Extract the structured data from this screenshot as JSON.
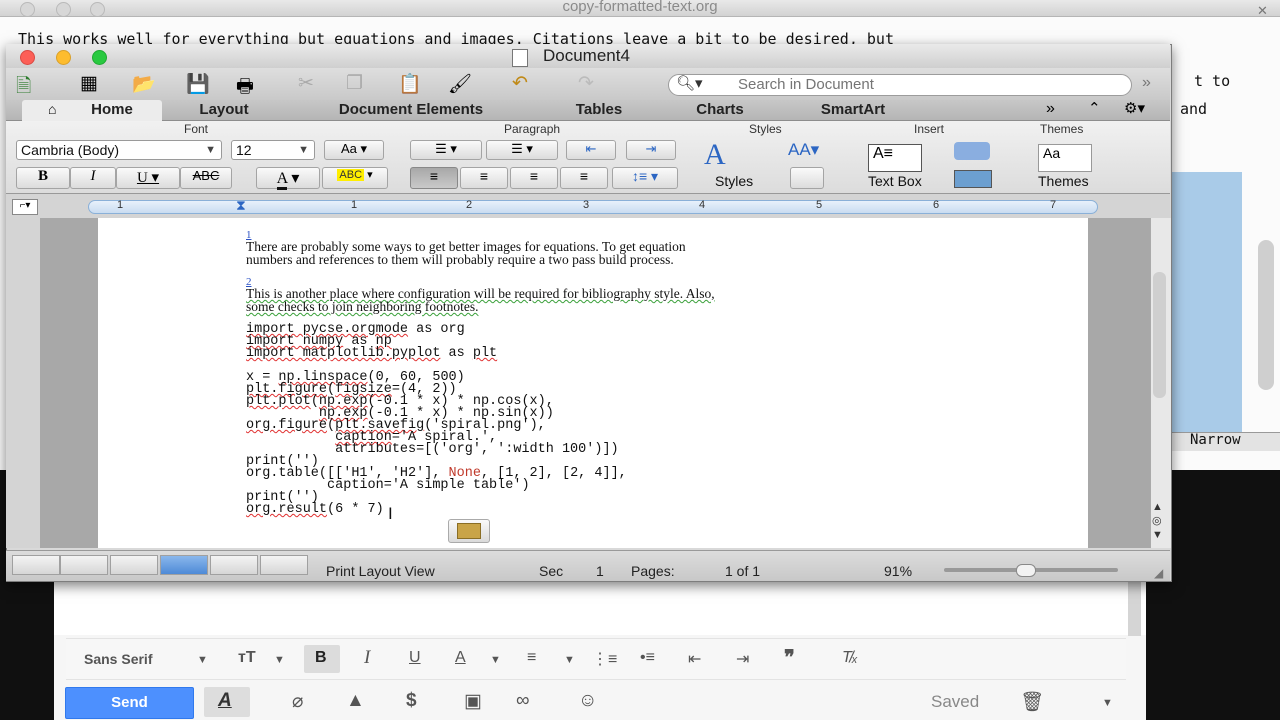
{
  "emacs": {
    "title": "copy-formatted-text.org",
    "line1": "This works well for everything but equations and images. Citations leave a bit to be desired, but",
    "right1": "t to",
    "right2": "and",
    "modeline": "Narrow"
  },
  "word": {
    "title": "Document4",
    "search_placeholder": "Search in Document",
    "tabs": [
      "Home",
      "Layout",
      "Document Elements",
      "Tables",
      "Charts",
      "SmartArt"
    ],
    "groups": {
      "font": "Font",
      "paragraph": "Paragraph",
      "styles": "Styles",
      "insert": "Insert",
      "themes": "Themes"
    },
    "font_name": "Cambria (Body)",
    "font_size": "12",
    "styles_label": "Styles",
    "textbox_label": "Text Box",
    "themes_label": "Themes",
    "ruler_numbers": [
      "1",
      "1",
      "2",
      "3",
      "4",
      "5",
      "6",
      "7"
    ],
    "doc": {
      "fn1_num": "1",
      "fn1_line1": "There are probably some ways to get better images for equations. To get equation",
      "fn1_line2": "numbers and references to them will probably require a two pass build process.",
      "fn2_num": "2",
      "fn2_line1": "This is another place where configuration will be required for bibliography style. Also,",
      "fn2_line2": "some checks to join neighboring footnotes."
    },
    "status": {
      "view": "Print Layout View",
      "sec_label": "Sec",
      "sec_value": "1",
      "pages_label": "Pages:",
      "pages_value": "1 of 1",
      "zoom": "91%"
    }
  },
  "gmail": {
    "font": "Sans Serif",
    "send": "Send",
    "saved": "Saved"
  }
}
